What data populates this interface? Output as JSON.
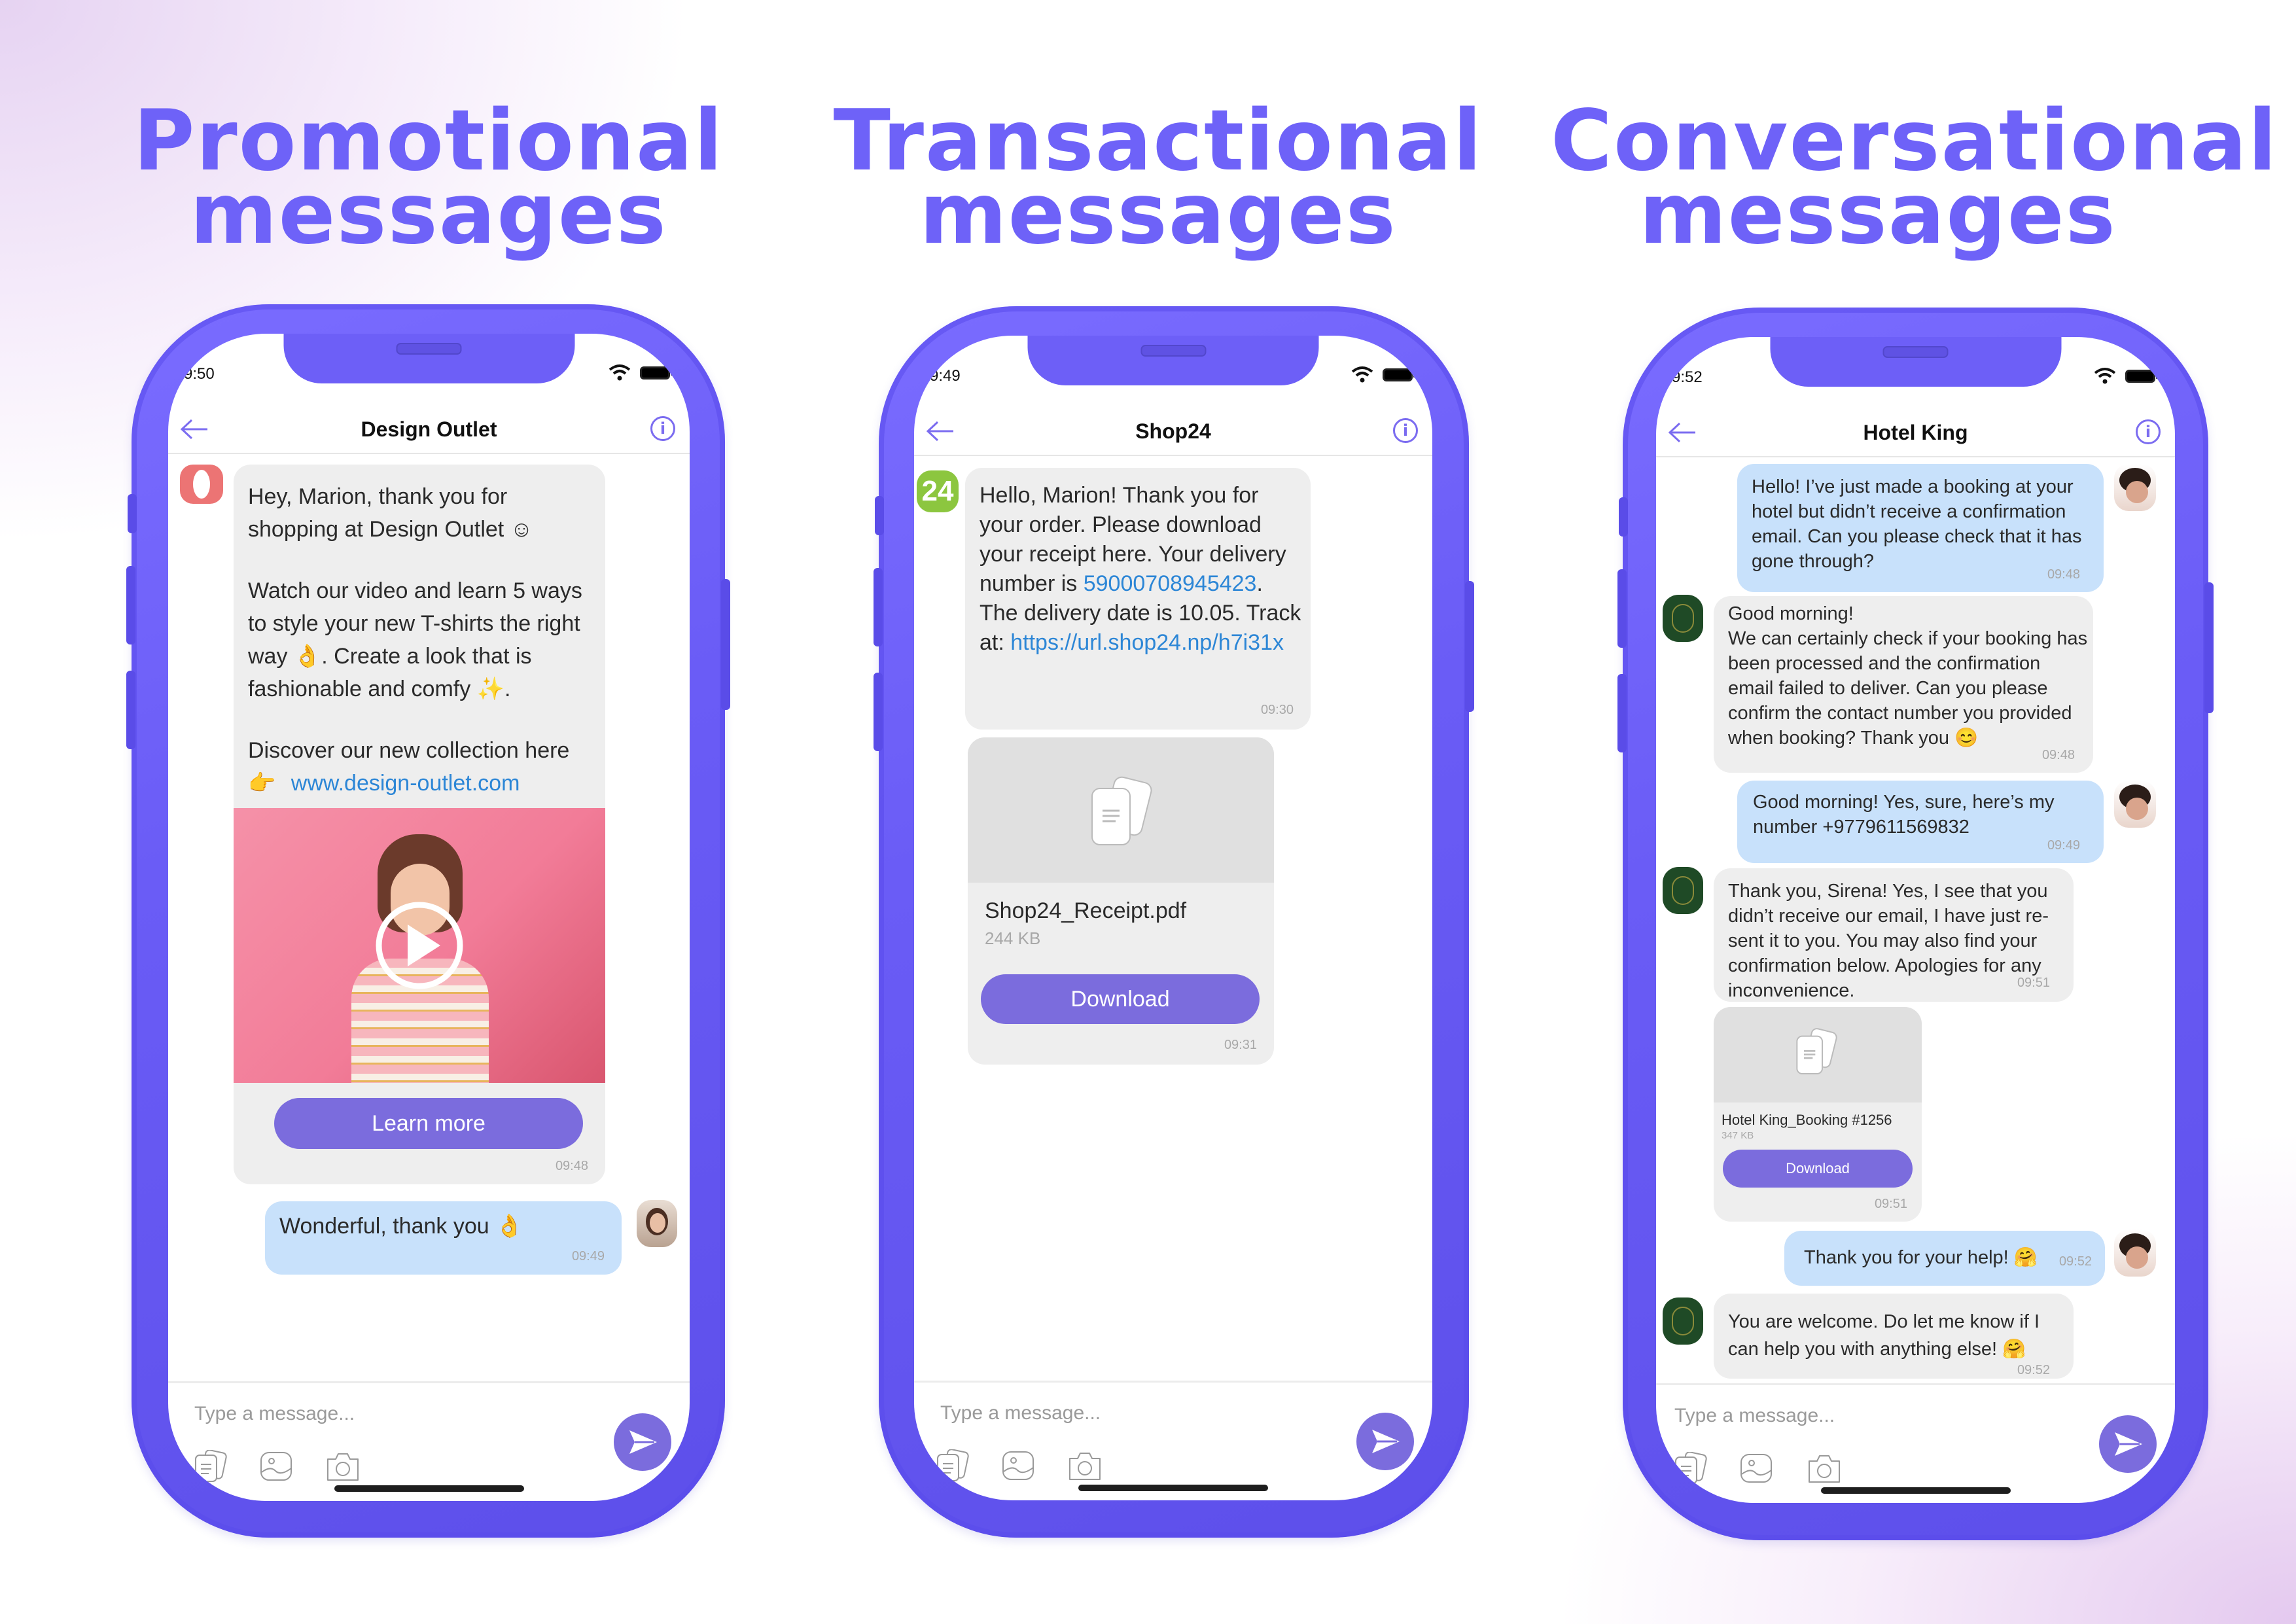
{
  "headings": [
    {
      "line1": "Promotional",
      "line2": "messages"
    },
    {
      "line1": "Transactional",
      "line2": "messages"
    },
    {
      "line1": "Conversational",
      "line2": "messages"
    }
  ],
  "colors": {
    "accent": "#6e62f8",
    "phone_frame": "#6a5cf6",
    "button": "#7b6cdd",
    "incoming_bubble": "#eeeeee",
    "outgoing_bubble": "#c8e1fb",
    "link": "#2c86d6"
  },
  "phones": [
    {
      "status_time": "9:50",
      "chat_title": "Design Outlet",
      "placeholder": "Type a message...",
      "messages": {
        "promo": {
          "para1": "Hey, Marion, thank you for shopping at Design Outlet ☺",
          "para2": "Watch our video and learn 5 ways to style your new T-shirts the right way 👌. Create a look that is fashionable and comfy ✨.",
          "para3": "Discover our new collection here",
          "pointer_emoji": "👉",
          "link": "www.design-outlet.com",
          "button": "Learn more",
          "time": "09:48"
        },
        "reply": {
          "text": "Wonderful, thank you 👌",
          "time": "09:49"
        }
      }
    },
    {
      "status_time": "9:49",
      "chat_title": "Shop24",
      "placeholder": "Type a message...",
      "avatar_text": "24",
      "messages": {
        "receipt": {
          "text_before": "Hello, Marion! Thank you for your order. Please download your receipt here. Your delivery number is ",
          "delivery_number": "59000708945423",
          "text_middle": ". The delivery date is 10.05. Track at: ",
          "track_link": "https://url.shop24.np/h7i31x",
          "time": "09:30"
        },
        "file": {
          "name": "Shop24_Receipt.pdf",
          "size": "244 KB",
          "button": "Download",
          "time": "09:31"
        }
      }
    },
    {
      "status_time": "9:52",
      "chat_title": "Hotel King",
      "placeholder": "Type a message...",
      "messages": [
        {
          "dir": "out",
          "text": "Hello! I’ve just made a booking at your hotel but didn’t receive a confirmation email. Can you please check that it has gone through?",
          "time": "09:48"
        },
        {
          "dir": "in",
          "text": "Good morning!\nWe can certainly check if your booking has been processed and the confirmation email failed to deliver. Can you please confirm the contact number you provided when booking? Thank you 😊",
          "time": "09:48"
        },
        {
          "dir": "out",
          "text": "Good morning! Yes, sure, here’s my number +9779611569832",
          "time": "09:49"
        },
        {
          "dir": "in",
          "text": "Thank you, Sirena! Yes, I see that you didn’t receive our email, I have just re-sent it to you. You may also find your confirmation below. Apologies for any inconvenience.",
          "time": "09:51"
        },
        {
          "dir": "in",
          "type": "file",
          "name": "Hotel King_Booking #1256",
          "size": "347 KB",
          "button": "Download",
          "time": "09:51"
        },
        {
          "dir": "out",
          "text": "Thank you for your help! 🤗",
          "time": "09:52"
        },
        {
          "dir": "in",
          "text": "You are welcome. Do let me know if I can help you with anything else! 🤗",
          "time": "09:52"
        }
      ]
    }
  ],
  "icons": [
    "back-arrow-icon",
    "info-icon",
    "wifi-icon",
    "battery-icon",
    "document-icon",
    "gallery-icon",
    "camera-icon",
    "send-icon",
    "play-icon"
  ]
}
